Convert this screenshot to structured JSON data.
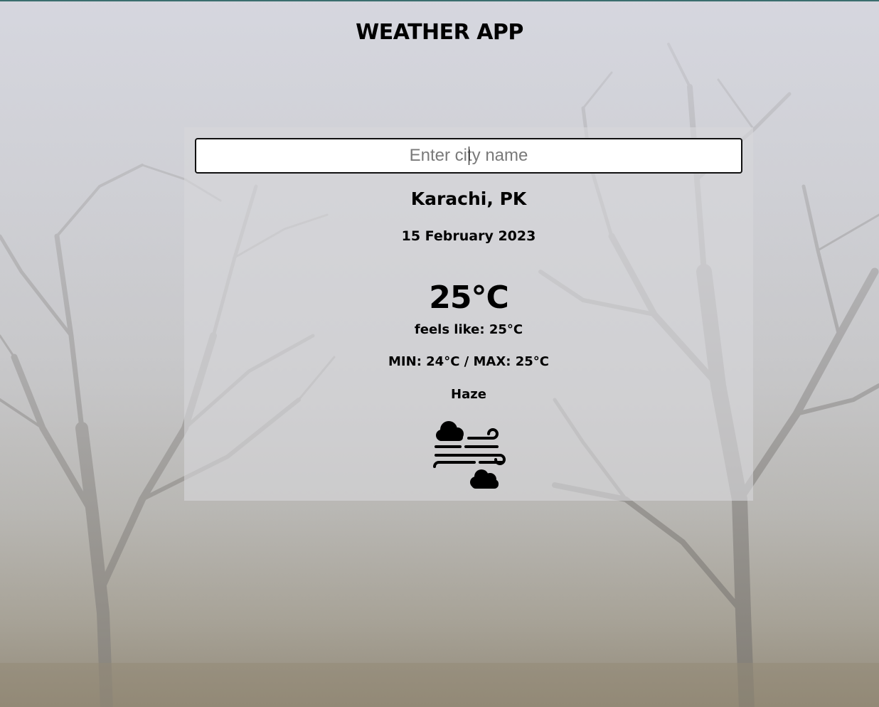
{
  "app": {
    "title": "WEATHER APP"
  },
  "search": {
    "placeholder": "Enter city name",
    "value": ""
  },
  "weather": {
    "location": "Karachi, PK",
    "date": "15 February 2023",
    "temperature": "25°C",
    "feels_like_label": "feels like:",
    "feels_like_value": "25°C",
    "min_max": "MIN: 24°C / MAX: 25°C",
    "condition": "Haze",
    "icon": "haze-wind-cloud-icon"
  },
  "colors": {
    "card_background": "#d7d7da",
    "text": "#000000",
    "input_border": "#111111",
    "top_border": "#3b6e6e"
  }
}
